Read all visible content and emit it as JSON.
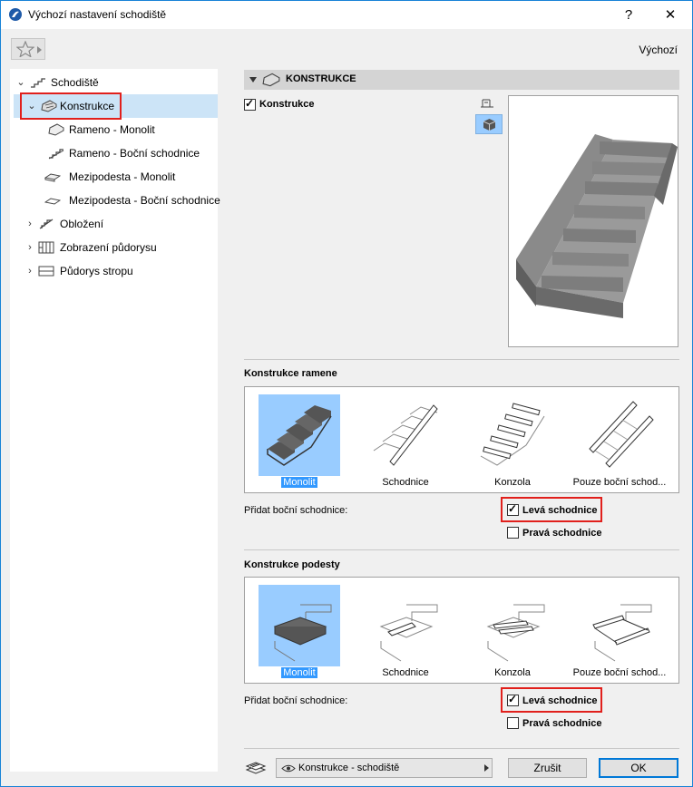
{
  "window": {
    "title": "Výchozí nastavení schodiště",
    "help_label": "?",
    "close_label": "✕"
  },
  "toolbar": {
    "favorites_icon": "star-icon",
    "default_label": "Výchozí"
  },
  "tree": {
    "items": [
      {
        "label": "Schodiště",
        "icon": "stair-icon"
      },
      {
        "label": "Konstrukce",
        "icon": "structure-icon"
      },
      {
        "label": "Rameno - Monolit",
        "icon": "flight-monolithic-icon"
      },
      {
        "label": "Rameno - Boční schodnice",
        "icon": "flight-stringer-icon"
      },
      {
        "label": "Mezipodesta - Monolit",
        "icon": "landing-monolithic-icon"
      },
      {
        "label": "Mezipodesta - Boční schodnice",
        "icon": "landing-stringer-icon"
      },
      {
        "label": "Obložení",
        "icon": "finish-icon"
      },
      {
        "label": "Zobrazení půdorysu",
        "icon": "floor-plan-icon"
      },
      {
        "label": "Půdorys stropu",
        "icon": "ceiling-plan-icon"
      }
    ]
  },
  "section": {
    "title": "KONSTRUKCE",
    "checkbox_label": "Konstrukce",
    "checkbox_checked": true
  },
  "flight": {
    "title": "Konstrukce ramene",
    "options": [
      "Monolit",
      "Schodnice",
      "Konzola",
      "Pouze boční schod..."
    ],
    "selected": "Monolit",
    "add_stringer_label": "Přidat boční schodnice:",
    "left_label": "Levá schodnice",
    "left_checked": true,
    "right_label": "Pravá schodnice",
    "right_checked": false
  },
  "landing": {
    "title": "Konstrukce podesty",
    "options": [
      "Monolit",
      "Schodnice",
      "Konzola",
      "Pouze boční schod..."
    ],
    "selected": "Monolit",
    "add_stringer_label": "Přidat boční schodnice:",
    "left_label": "Levá schodnice",
    "left_checked": true,
    "right_label": "Pravá schodnice",
    "right_checked": false
  },
  "footer": {
    "dropdown_label": "Konstrukce - schodiště",
    "cancel_label": "Zrušit",
    "ok_label": "OK"
  },
  "colors": {
    "selection_bg": "#99ccff",
    "selection_text_bg": "#3399ff",
    "highlight_red": "#e1201c",
    "accent": "#0078d7"
  }
}
